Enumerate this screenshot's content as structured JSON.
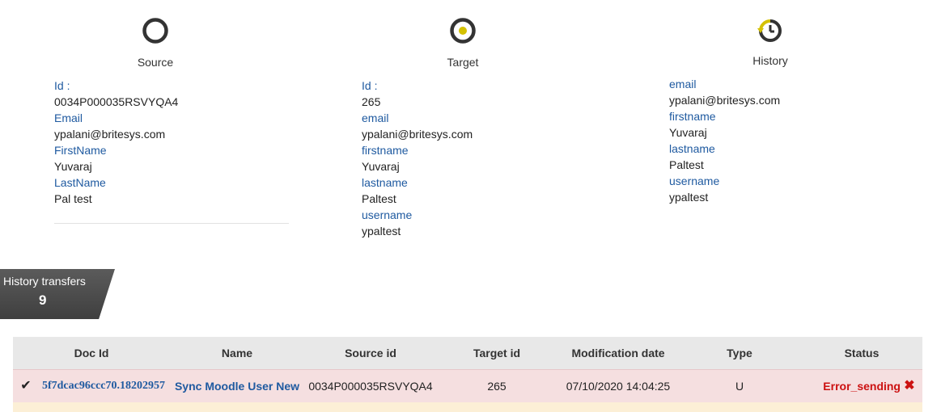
{
  "source": {
    "title": "Source",
    "fields": [
      {
        "label": "Id :",
        "value": "0034P000035RSVYQA4"
      },
      {
        "label": "Email",
        "value": "ypalani@britesys.com"
      },
      {
        "label": "FirstName",
        "value": "Yuvaraj"
      },
      {
        "label": "LastName",
        "value": "Pal test"
      }
    ]
  },
  "target": {
    "title": "Target",
    "fields": [
      {
        "label": "Id :",
        "value": "265"
      },
      {
        "label": "email",
        "value": "ypalani@britesys.com"
      },
      {
        "label": "firstname",
        "value": "Yuvaraj"
      },
      {
        "label": "lastname",
        "value": "Paltest"
      },
      {
        "label": "username",
        "value": "ypaltest"
      }
    ]
  },
  "history": {
    "title": "History",
    "fields": [
      {
        "label": "email",
        "value": "ypalani@britesys.com"
      },
      {
        "label": "firstname",
        "value": "Yuvaraj"
      },
      {
        "label": "lastname",
        "value": "Paltest"
      },
      {
        "label": "username",
        "value": "ypaltest"
      }
    ]
  },
  "transfers": {
    "label": "History transfers",
    "count": "9"
  },
  "table": {
    "headers": [
      "Doc Id",
      "Name",
      "Source id",
      "Target id",
      "Modification date",
      "Type",
      "Status"
    ],
    "rows": [
      {
        "doc_id": "5f7dcac96ccc70.18202957",
        "name": "Sync Moodle User New",
        "source_id": "0034P000035RSVYQA4",
        "target_id": "265",
        "date": "07/10/2020 14:04:25",
        "type": "U",
        "status": "Error_sending"
      }
    ]
  },
  "icons": {
    "source": "circle-outline-icon",
    "target": "circle-target-icon",
    "history": "clock-history-icon",
    "check": "checkmark-icon",
    "error": "x-mark-icon"
  },
  "colors": {
    "label_blue": "#1f5aa0",
    "target_yellow": "#d4c100",
    "error_red": "#cc1111",
    "row_error_bg": "#f5dfe0",
    "row_warn_bg": "#fcefd6"
  }
}
